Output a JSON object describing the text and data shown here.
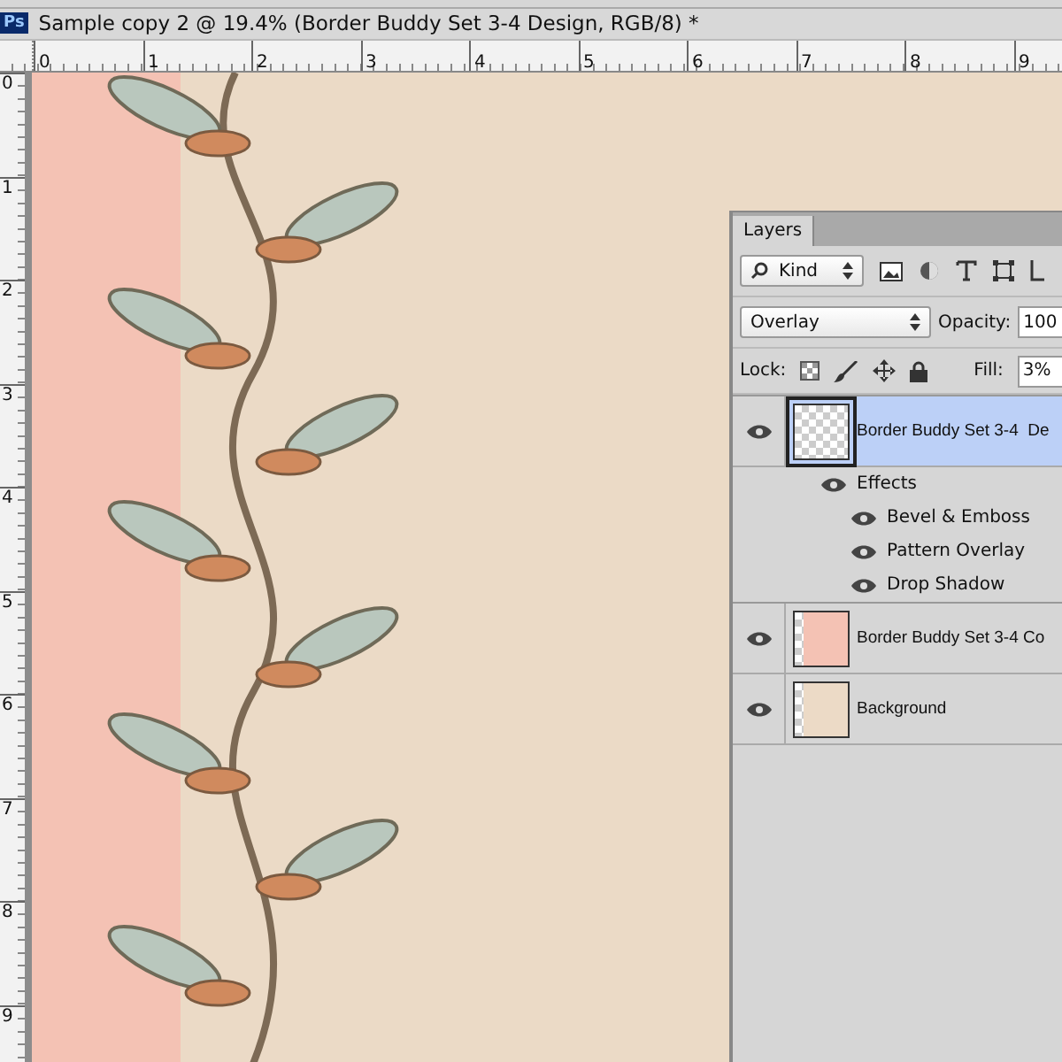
{
  "window": {
    "title": "Sample copy 2 @ 19.4%  (Border Buddy Set 3-4  Design, RGB/8) *",
    "app_badge": "Ps"
  },
  "ruler_h": [
    "0",
    "1",
    "2",
    "3",
    "4",
    "5",
    "6",
    "7",
    "8",
    "9"
  ],
  "ruler_v": [
    "0",
    "1",
    "2",
    "3",
    "4",
    "5",
    "6",
    "7",
    "8",
    "9"
  ],
  "layers_panel": {
    "tab": "Layers",
    "filter": {
      "value": "Kind"
    },
    "blend_mode": {
      "value": "Overlay"
    },
    "opacity": {
      "label": "Opacity:",
      "value": "100"
    },
    "lock": {
      "label": "Lock:"
    },
    "fill": {
      "label": "Fill:",
      "value": "3%"
    },
    "layers": [
      {
        "name": "Border Buddy Set 3-4  De",
        "selected": true,
        "effects": {
          "label": "Effects",
          "items": [
            "Bevel & Emboss",
            "Pattern Overlay",
            "Drop Shadow"
          ]
        }
      },
      {
        "name": "Border Buddy Set 3-4 Co",
        "selected": false,
        "color": "#f4c2b4"
      },
      {
        "name": "Background",
        "selected": false,
        "color": "#ecdac6"
      }
    ]
  }
}
